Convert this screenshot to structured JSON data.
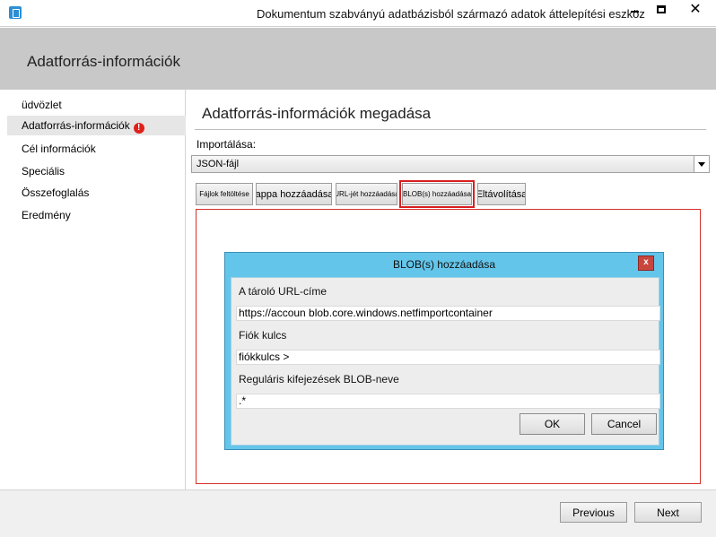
{
  "window": {
    "title": "Dokumentum szabványú adatbázisból származó adatok áttelepítési eszköz",
    "close_glyph": "✕"
  },
  "header": {
    "title": "Adatforrás-információk"
  },
  "sidebar": {
    "items": [
      {
        "label": "üdvözlet"
      },
      {
        "label": "Adatforrás-információk",
        "warning": "!"
      },
      {
        "label": "Cél információk"
      },
      {
        "label": "Speciális"
      },
      {
        "label": "Összefoglalás"
      },
      {
        "label": "Eredmény"
      }
    ]
  },
  "main": {
    "title": "Adatforrás-információk megadása",
    "import_label": "Importálása:",
    "import_value": "JSON-fájl",
    "toolbar": {
      "add_files": "Fájlok feltöltése",
      "add_folder": "Mappa hozzáadása",
      "add_url": "URL-jét hozzáadása",
      "add_blob": "BLOB(s) hozzáadása",
      "remove": "Eltávolítása"
    }
  },
  "dialog": {
    "title": "BLOB(s) hozzáadása",
    "close_glyph": "x",
    "container_url_label": "A tároló URL-címe",
    "container_url_value": "https://accoun blob.core.windows.netfimportcontainer",
    "account_key_label": "Fiók kulcs",
    "account_key_value": "fiókkulcs >",
    "regex_label": "Reguláris kifejezések BLOB-neve",
    "regex_value": ".*",
    "ok": "OK",
    "cancel": "Cancel"
  },
  "footer": {
    "previous": "Previous",
    "next": "Next"
  },
  "colors": {
    "accent_red": "#d81e1e",
    "dialog_blue": "#64c5ea",
    "header_gray": "#c8c8c8"
  }
}
